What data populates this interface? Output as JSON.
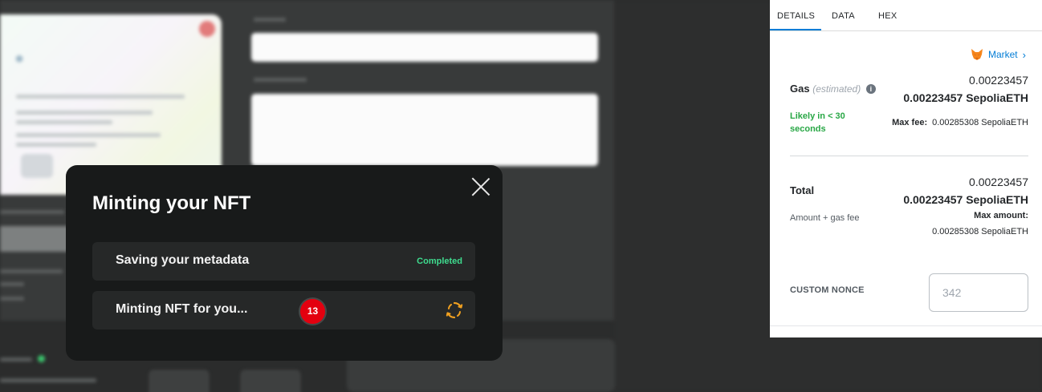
{
  "modal": {
    "title": "Minting your NFT",
    "steps": [
      {
        "label": "Saving your metadata",
        "status": "Completed",
        "status_color": "#3fdc8f"
      },
      {
        "label": "Minting NFT for you...",
        "status_icon": "refresh-spinner-icon",
        "icon_color": "#f0a020"
      }
    ],
    "close_icon": "close-icon"
  },
  "badge": {
    "count": "13",
    "color": "#e3000f"
  },
  "wallet": {
    "tabs": [
      "DETAILS",
      "DATA",
      "HEX"
    ],
    "active_tab": "DETAILS",
    "market_label": "Market",
    "gas": {
      "label": "Gas",
      "estimated": "(estimated)",
      "value": "0.00223457",
      "value_bold": "0.00223457 SepoliaETH",
      "likely": "Likely in < 30 seconds",
      "max_fee_label": "Max fee:",
      "max_fee_value": "0.00285308 SepoliaETH"
    },
    "total": {
      "label": "Total",
      "value": "0.00223457",
      "value_bold": "0.00223457 SepoliaETH",
      "sub_label": "Amount + gas fee",
      "max_amount_label": "Max amount:",
      "max_amount_value": "0.00285308 SepoliaETH"
    },
    "nonce": {
      "label": "CUSTOM NONCE",
      "placeholder": "342"
    },
    "accent_color": "#037dd6",
    "success_color": "#28a745"
  }
}
